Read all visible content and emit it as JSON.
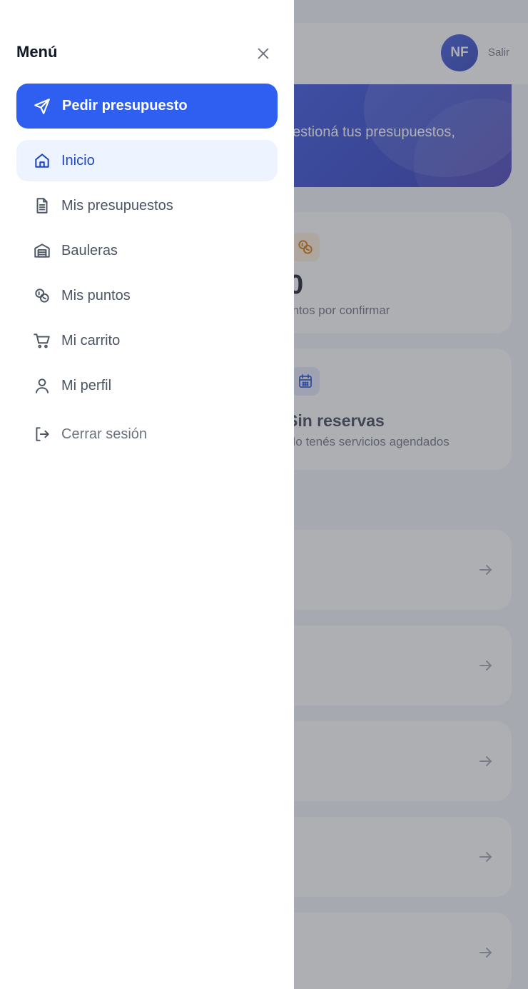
{
  "background": {
    "header": {
      "avatar_initials": "NF",
      "logout_label": "Salir"
    },
    "hero": {
      "text": "estioná tus presupuestos,"
    },
    "points_card": {
      "value": "0",
      "caption": "untos por confirmar"
    },
    "reservations_card": {
      "title": "Sin reservas",
      "caption": "No tenés servicios agendados"
    }
  },
  "drawer": {
    "title": "Menú",
    "cta_label": "Pedir presupuesto",
    "items": [
      {
        "label": "Inicio",
        "icon": "home-icon",
        "active": true
      },
      {
        "label": "Mis presupuestos",
        "icon": "document-icon"
      },
      {
        "label": "Bauleras",
        "icon": "storage-icon"
      },
      {
        "label": "Mis puntos",
        "icon": "coins-icon"
      },
      {
        "label": "Mi carrito",
        "icon": "cart-icon"
      },
      {
        "label": "Mi perfil",
        "icon": "user-icon"
      }
    ],
    "logout_label": "Cerrar sesión"
  },
  "colors": {
    "primary": "#2f5ff0",
    "active_bg": "#eef4ff",
    "active_text": "#1f45c8"
  }
}
